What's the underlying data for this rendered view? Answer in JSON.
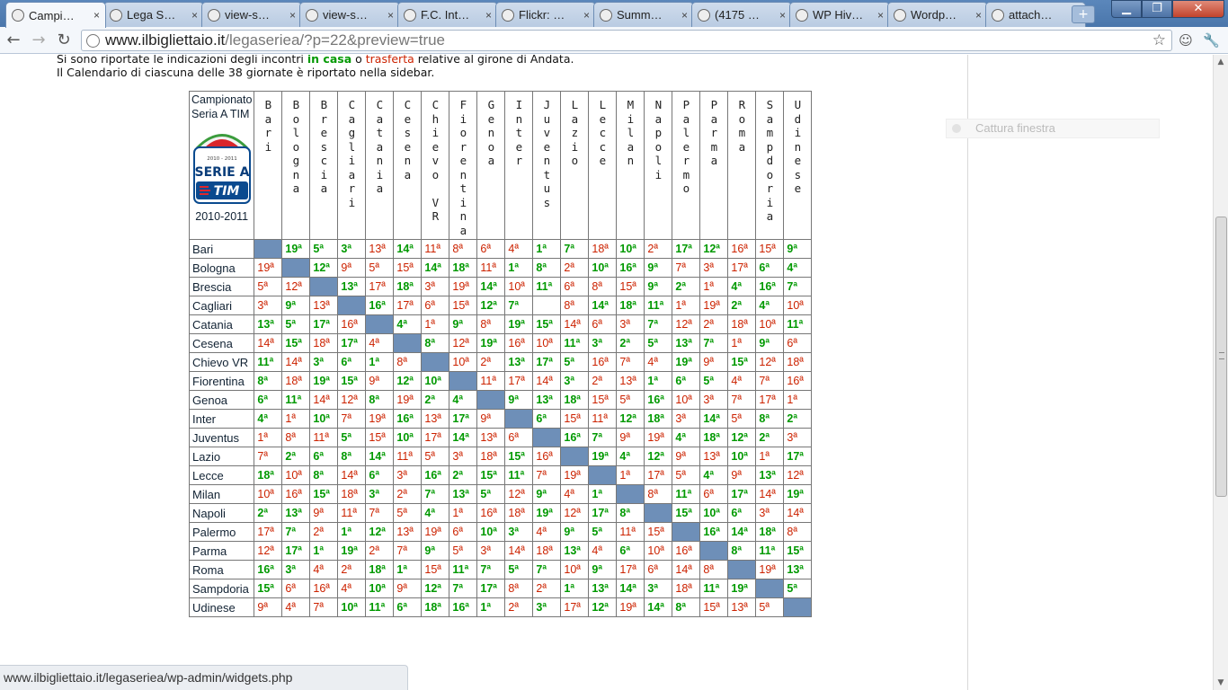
{
  "tabs": [
    {
      "label": "Campi…",
      "icon": "wordpress-icon",
      "active": true
    },
    {
      "label": "Lega S…",
      "icon": "wordpress-icon"
    },
    {
      "label": "view-s…",
      "icon": "wordpress-icon"
    },
    {
      "label": "view-s…",
      "icon": "wordpress-icon"
    },
    {
      "label": "F.C. Int…",
      "icon": "facebook-icon"
    },
    {
      "label": "Flickr: …",
      "icon": "flickr-icon"
    },
    {
      "label": "Summ…",
      "icon": "summary-icon"
    },
    {
      "label": "(4175 …",
      "icon": "yahoo-icon"
    },
    {
      "label": "WP Hiv…",
      "icon": "page-icon"
    },
    {
      "label": "Wordp…",
      "icon": "wordpress-icon"
    },
    {
      "label": "attach…",
      "icon": "wr-icon"
    }
  ],
  "address": {
    "host": "www.ilbigliettaio.it",
    "path": "/legaseriea/?p=22&preview=true"
  },
  "intro": {
    "line1_pre": "Si sono riportate le indicazioni degli incontri ",
    "in_casa": "in casa",
    "o": " o ",
    "trasferta": "trasferta",
    "line1_post": " relative al girone di Andata.",
    "line2": "Il Calendario di ciascuna delle 38 giornate è riportato nella sidebar."
  },
  "table": {
    "title": "Campionato Seria A TIM",
    "season": "2010-2011",
    "logo": {
      "text_season": "2010 - 2011",
      "text_main": "SERIE A",
      "text_sponsor": "TIM"
    },
    "teams": [
      "Bari",
      "Bologna",
      "Brescia",
      "Cagliari",
      "Catania",
      "Cesena",
      "Chievo VR",
      "Fiorentina",
      "Genoa",
      "Inter",
      "Juventus",
      "Lazio",
      "Lecce",
      "Milan",
      "Napoli",
      "Palermo",
      "Parma",
      "Roma",
      "Sampdoria",
      "Udinese"
    ],
    "rows": [
      [
        "",
        "19ª*",
        "5ª*",
        "3ª*",
        "13ª",
        "14ª*",
        "11ª",
        "8ª",
        "6ª",
        "4ª",
        "1ª*",
        "7ª*",
        "18ª",
        "10ª*",
        "2ª",
        "17ª*",
        "12ª*",
        "16ª",
        "15ª",
        "9ª*"
      ],
      [
        "19ª",
        "",
        "12ª*",
        "9ª",
        "5ª",
        "15ª",
        "14ª*",
        "18ª*",
        "11ª",
        "1ª*",
        "8ª*",
        "2ª",
        "10ª*",
        "16ª*",
        "9ª*",
        "7ª",
        "3ª",
        "17ª",
        "6ª*",
        "4ª*"
      ],
      [
        "5ª",
        "12ª",
        "",
        "13ª*",
        "17ª",
        "18ª*",
        "3ª",
        "19ª",
        "14ª*",
        "10ª",
        "11ª*",
        "6ª",
        "8ª",
        "15ª",
        "9ª*",
        "2ª*",
        "1ª",
        "4ª*",
        "16ª*",
        "7ª*"
      ],
      [
        "3ª",
        "9ª*",
        "13ª",
        "",
        "16ª*",
        "17ª",
        "6ª",
        "15ª",
        "12ª*",
        "7ª*",
        "",
        "8ª",
        "14ª*",
        "18ª*",
        "11ª*",
        "1ª",
        "19ª",
        "2ª*",
        "4ª*",
        "10ª"
      ],
      [
        "13ª*",
        "5ª*",
        "17ª*",
        "16ª",
        "",
        "4ª*",
        "1ª",
        "9ª*",
        "8ª",
        "19ª*",
        "15ª*",
        "14ª",
        "6ª",
        "3ª",
        "7ª*",
        "12ª",
        "2ª",
        "18ª",
        "10ª",
        "11ª*"
      ],
      [
        "14ª",
        "15ª*",
        "18ª",
        "17ª*",
        "4ª",
        "",
        "8ª*",
        "12ª",
        "19ª*",
        "16ª",
        "10ª",
        "11ª*",
        "3ª*",
        "2ª*",
        "5ª*",
        "13ª*",
        "7ª*",
        "1ª",
        "9ª*",
        "6ª"
      ],
      [
        "11ª*",
        "14ª",
        "3ª*",
        "6ª*",
        "1ª*",
        "8ª",
        "",
        "10ª",
        "2ª",
        "13ª*",
        "17ª*",
        "5ª*",
        "16ª",
        "7ª",
        "4ª",
        "19ª*",
        "9ª",
        "15ª*",
        "12ª",
        "18ª"
      ],
      [
        "8ª*",
        "18ª",
        "19ª*",
        "15ª*",
        "9ª",
        "12ª*",
        "10ª*",
        "",
        "11ª",
        "17ª",
        "14ª",
        "3ª*",
        "2ª",
        "13ª",
        "1ª*",
        "6ª*",
        "5ª*",
        "4ª",
        "7ª",
        "16ª"
      ],
      [
        "6ª*",
        "11ª*",
        "14ª",
        "12ª",
        "8ª*",
        "19ª",
        "2ª*",
        "4ª*",
        "",
        "9ª*",
        "13ª*",
        "18ª*",
        "15ª",
        "5ª",
        "16ª*",
        "10ª",
        "3ª",
        "7ª",
        "17ª",
        "1ª"
      ],
      [
        "4ª*",
        "1ª",
        "10ª*",
        "7ª",
        "19ª",
        "16ª*",
        "13ª",
        "17ª*",
        "9ª",
        "",
        "6ª*",
        "15ª",
        "11ª",
        "12ª*",
        "18ª*",
        "3ª",
        "14ª*",
        "5ª",
        "8ª*",
        "2ª*"
      ],
      [
        "1ª",
        "8ª",
        "11ª",
        "5ª*",
        "15ª",
        "10ª*",
        "17ª",
        "14ª*",
        "13ª",
        "6ª",
        "",
        "16ª*",
        "7ª*",
        "9ª",
        "19ª",
        "4ª*",
        "18ª*",
        "12ª*",
        "2ª*",
        "3ª"
      ],
      [
        "7ª",
        "2ª*",
        "6ª*",
        "8ª*",
        "14ª*",
        "11ª",
        "5ª",
        "3ª",
        "18ª",
        "15ª*",
        "16ª",
        "",
        "19ª*",
        "4ª*",
        "12ª*",
        "9ª",
        "13ª",
        "10ª*",
        "1ª",
        "17ª*"
      ],
      [
        "18ª*",
        "10ª",
        "8ª*",
        "14ª",
        "6ª*",
        "3ª",
        "16ª*",
        "2ª*",
        "15ª*",
        "11ª*",
        "7ª",
        "19ª",
        "",
        "1ª",
        "17ª",
        "5ª",
        "4ª*",
        "9ª",
        "13ª*",
        "12ª"
      ],
      [
        "10ª",
        "16ª",
        "15ª*",
        "18ª",
        "3ª*",
        "2ª",
        "7ª*",
        "13ª*",
        "5ª*",
        "12ª",
        "9ª*",
        "4ª",
        "1ª*",
        "",
        "8ª",
        "11ª*",
        "6ª",
        "17ª*",
        "14ª",
        "19ª*"
      ],
      [
        "2ª*",
        "13ª*",
        "9ª",
        "11ª",
        "7ª",
        "5ª",
        "4ª*",
        "1ª",
        "16ª",
        "18ª",
        "19ª*",
        "12ª",
        "17ª*",
        "8ª*",
        "",
        "15ª*",
        "10ª*",
        "6ª*",
        "3ª",
        "14ª"
      ],
      [
        "17ª",
        "7ª*",
        "2ª",
        "1ª*",
        "12ª*",
        "13ª",
        "19ª",
        "6ª",
        "10ª*",
        "3ª*",
        "4ª",
        "9ª*",
        "5ª*",
        "11ª",
        "15ª",
        "",
        "16ª*",
        "14ª*",
        "18ª*",
        "8ª"
      ],
      [
        "12ª",
        "17ª*",
        "1ª*",
        "19ª*",
        "2ª",
        "7ª",
        "9ª*",
        "5ª",
        "3ª",
        "14ª",
        "18ª",
        "13ª*",
        "4ª",
        "6ª*",
        "10ª",
        "16ª",
        "",
        "8ª*",
        "11ª*",
        "15ª*"
      ],
      [
        "16ª*",
        "3ª*",
        "4ª",
        "2ª",
        "18ª*",
        "1ª*",
        "15ª",
        "11ª*",
        "7ª*",
        "5ª*",
        "7ª*",
        "10ª",
        "9ª*",
        "17ª",
        "6ª",
        "14ª",
        "8ª",
        "",
        "19ª",
        "13ª*"
      ],
      [
        "15ª*",
        "6ª",
        "16ª",
        "4ª",
        "10ª*",
        "9ª",
        "12ª*",
        "7ª*",
        "17ª*",
        "8ª",
        "2ª",
        "1ª*",
        "13ª*",
        "14ª*",
        "3ª*",
        "18ª",
        "11ª*",
        "19ª*",
        "",
        "5ª*"
      ],
      [
        "9ª",
        "4ª",
        "7ª",
        "10ª*",
        "11ª*",
        "6ª*",
        "18ª*",
        "16ª*",
        "1ª*",
        "2ª",
        "3ª*",
        "17ª",
        "12ª*",
        "19ª",
        "14ª*",
        "8ª*",
        "15ª",
        "13ª",
        "5ª",
        ""
      ]
    ]
  },
  "sidebar": {
    "widget_label": "Cattura finestra"
  },
  "status_url": "www.ilbigliettaio.it/legaseriea/wp-admin/widgets.php",
  "colors": {
    "home": "#009900",
    "away": "#cc2200",
    "diagonal": "#6e8fb8",
    "titlebar": "#4a76ab"
  }
}
